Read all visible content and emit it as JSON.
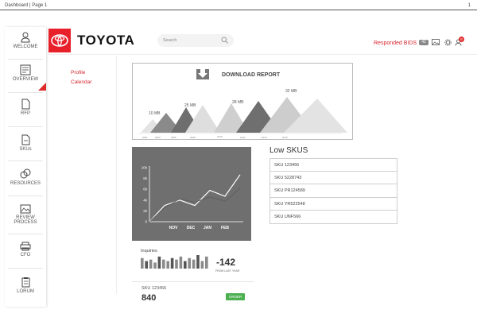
{
  "topbar": {
    "title": "Dashboard | Page 1",
    "page_number": "1"
  },
  "sidebar": {
    "items": [
      {
        "label": "WELCOME",
        "icon": "user-icon"
      },
      {
        "label": "OVERVIEW",
        "icon": "overview-icon",
        "active": true
      },
      {
        "label": "RFP",
        "icon": "document-icon"
      },
      {
        "label": "SKUs",
        "icon": "file-icon"
      },
      {
        "label": "RESOURCES",
        "icon": "resources-icon"
      },
      {
        "label": "REVIEW",
        "label2": "PROCESS",
        "icon": "review-icon"
      },
      {
        "label": "CFO",
        "icon": "printer-icon"
      },
      {
        "label": "LORUM",
        "icon": "clipboard-icon"
      }
    ],
    "accent": "#e02a2a"
  },
  "header": {
    "brand": "TOYOTA",
    "brand_color": "#e8202a",
    "search_placeholder": "Search",
    "responded_label": "Responded BIDS",
    "responded_count": "42",
    "notification_count": "8"
  },
  "subnav": {
    "items": [
      "Profile",
      "Calendar"
    ]
  },
  "report": {
    "title": "DOWNLOAD REPORT",
    "labels": [
      "10 MB",
      "25 MB",
      "28 MB",
      "32 MB"
    ],
    "axis": [
      "2001",
      "2003",
      "2005",
      "2008",
      "2010",
      "2012",
      "2013",
      "2015"
    ]
  },
  "low_skus": {
    "title": "Low SKUS",
    "items": [
      "SKU 123456",
      "SKU 5228743",
      "SKU  PR124589",
      "SKU  YR522548",
      "SKU  UNF566"
    ]
  },
  "chart_data": {
    "type": "line",
    "categories": [
      "NOV",
      "DEC",
      "JAN",
      "FEB"
    ],
    "yticks": [
      "10k",
      "8k",
      "6k",
      "4k",
      "2k",
      "0"
    ],
    "ylim": [
      0,
      10000
    ],
    "series": [
      {
        "values": [
          0,
          3000,
          4000,
          3000,
          5800,
          4700,
          8700
        ]
      },
      {
        "values": [
          0,
          2600,
          4200,
          3600,
          4600,
          3800,
          6200
        ]
      }
    ],
    "line_color": "#ffffff"
  },
  "inquiries": {
    "label": "Inquiries",
    "delta": "-142",
    "caption": "FROM LAST YEAR",
    "bars": [
      7,
      5,
      6,
      4,
      8,
      6,
      5,
      7,
      6,
      8,
      5,
      7,
      6,
      9,
      5,
      8
    ]
  },
  "sku_summary": {
    "label": "SKU 123456",
    "value": "840",
    "order_label": "ORDER",
    "order_color": "#4caf50"
  }
}
